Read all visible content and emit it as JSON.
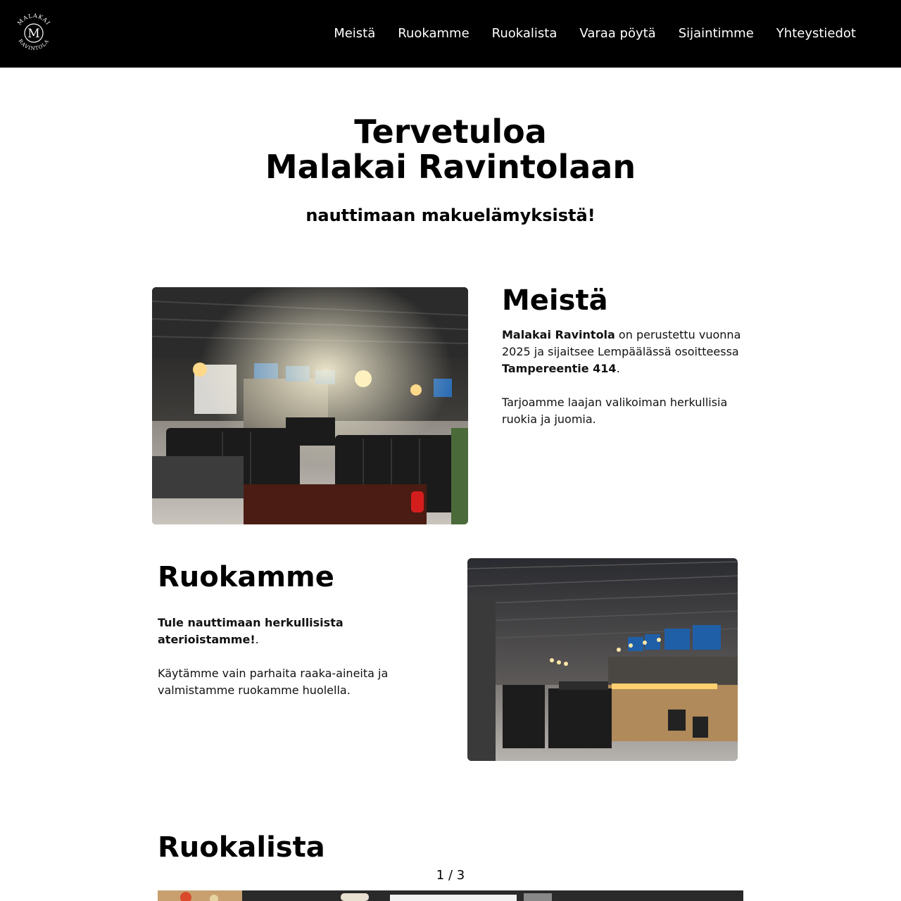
{
  "nav": {
    "logo_text_top": "MALAKAI",
    "logo_text_bottom": "RAVINTOLA",
    "logo_letter": "M",
    "items": [
      "Meistä",
      "Ruokamme",
      "Ruokalista",
      "Varaa pöytä",
      "Sijaintimme",
      "Yhteystiedot"
    ]
  },
  "hero": {
    "title_line1": "Tervetuloa",
    "title_line2": "Malakai Ravintolaan",
    "subtitle": "nauttimaan makuelämyksistä!"
  },
  "about": {
    "heading": "Meistä",
    "p1_bold1": "Malakai Ravintola",
    "p1_text1": " on perustettu vuonna 2025 ja sijaitsee Lempäälässä osoitteessa ",
    "p1_bold2": "Tampereentie 414",
    "p1_text2": ".",
    "p2": "Tarjoamme laajan valikoiman herkullisia ruokia ja juomia."
  },
  "food": {
    "heading": "Ruokamme",
    "p1_bold": "Tule nauttimaan herkullisista aterioistamme!",
    "p1_text": ".",
    "p2": "Käytämme vain parhaita raaka-aineita ja valmistamme ruokamme huolella."
  },
  "menu_section": {
    "heading": "Ruokalista",
    "counter": "1 / 3"
  },
  "colors": {
    "nav_bg": "#000000",
    "text": "#000000",
    "page_bg": "#ffffff"
  }
}
